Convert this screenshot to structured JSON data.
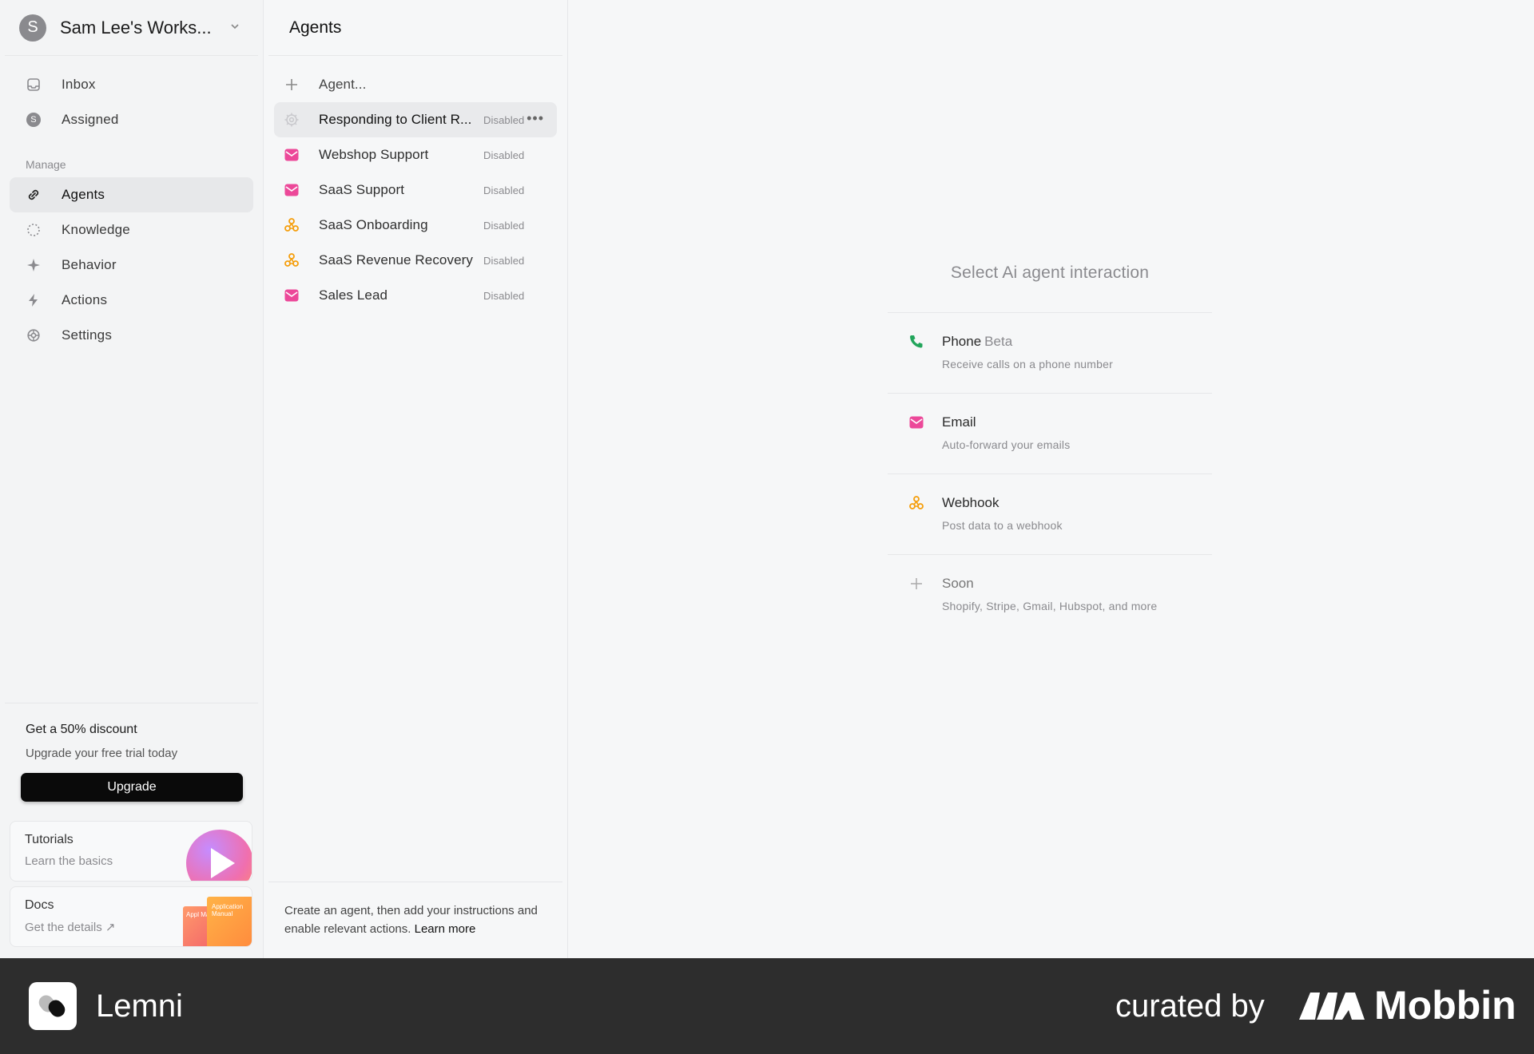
{
  "workspace": {
    "initial": "S",
    "name": "Sam Lee's Works..."
  },
  "sidebar": {
    "top_items": [
      {
        "label": "Inbox",
        "icon": "inbox-icon"
      },
      {
        "label": "Assigned",
        "icon": "avatar-s-icon",
        "avatar": "S"
      }
    ],
    "section_label": "Manage",
    "manage_items": [
      {
        "label": "Agents",
        "icon": "link-icon",
        "active": true
      },
      {
        "label": "Knowledge",
        "icon": "dotted-circle-icon"
      },
      {
        "label": "Behavior",
        "icon": "sparkle-icon"
      },
      {
        "label": "Actions",
        "icon": "lightning-icon"
      },
      {
        "label": "Settings",
        "icon": "gear-icon"
      }
    ],
    "promo": {
      "title": "Get a 50% discount",
      "subtitle": "Upgrade your free trial today",
      "button": "Upgrade"
    },
    "tutorials": {
      "title": "Tutorials",
      "subtitle": "Learn the basics"
    },
    "docs": {
      "title": "Docs",
      "subtitle": "Get the details ↗",
      "thumb_text_a": "Application Manual",
      "thumb_text_b": "Appl Man"
    }
  },
  "agents": {
    "title": "Agents",
    "new_label": "Agent...",
    "items": [
      {
        "name": "Responding to Client R...",
        "status": "Disabled",
        "icon": "gear-icon",
        "selected": true
      },
      {
        "name": "Webshop Support",
        "status": "Disabled",
        "icon": "email-icon"
      },
      {
        "name": "SaaS Support",
        "status": "Disabled",
        "icon": "email-icon"
      },
      {
        "name": "SaaS Onboarding",
        "status": "Disabled",
        "icon": "webhook-icon"
      },
      {
        "name": "SaaS Revenue Recovery",
        "status": "Disabled",
        "icon": "webhook-icon"
      },
      {
        "name": "Sales Lead",
        "status": "Disabled",
        "icon": "email-icon"
      }
    ],
    "more_menu": "•••",
    "footer_text": "Create an agent, then add your instructions and enable relevant actions.",
    "footer_link": "Learn more"
  },
  "main": {
    "title": "Select Ai agent interaction",
    "options": [
      {
        "title": "Phone",
        "badge": "Beta",
        "subtitle": "Receive calls on a phone number",
        "icon": "phone-icon"
      },
      {
        "title": "Email",
        "subtitle": "Auto-forward your emails",
        "icon": "email-icon"
      },
      {
        "title": "Webhook",
        "subtitle": "Post data to a webhook",
        "icon": "webhook-icon"
      },
      {
        "title": "Soon",
        "subtitle": "Shopify, Stripe, Gmail, Hubspot, and more",
        "icon": "plus-icon"
      }
    ]
  },
  "footer": {
    "brand": "Lemni",
    "curated": "curated by",
    "curator": "Mobbin"
  },
  "colors": {
    "email": "#ec4899",
    "webhook": "#f59e0b",
    "phone": "#22a55b",
    "accent": "#0a0a0a"
  }
}
